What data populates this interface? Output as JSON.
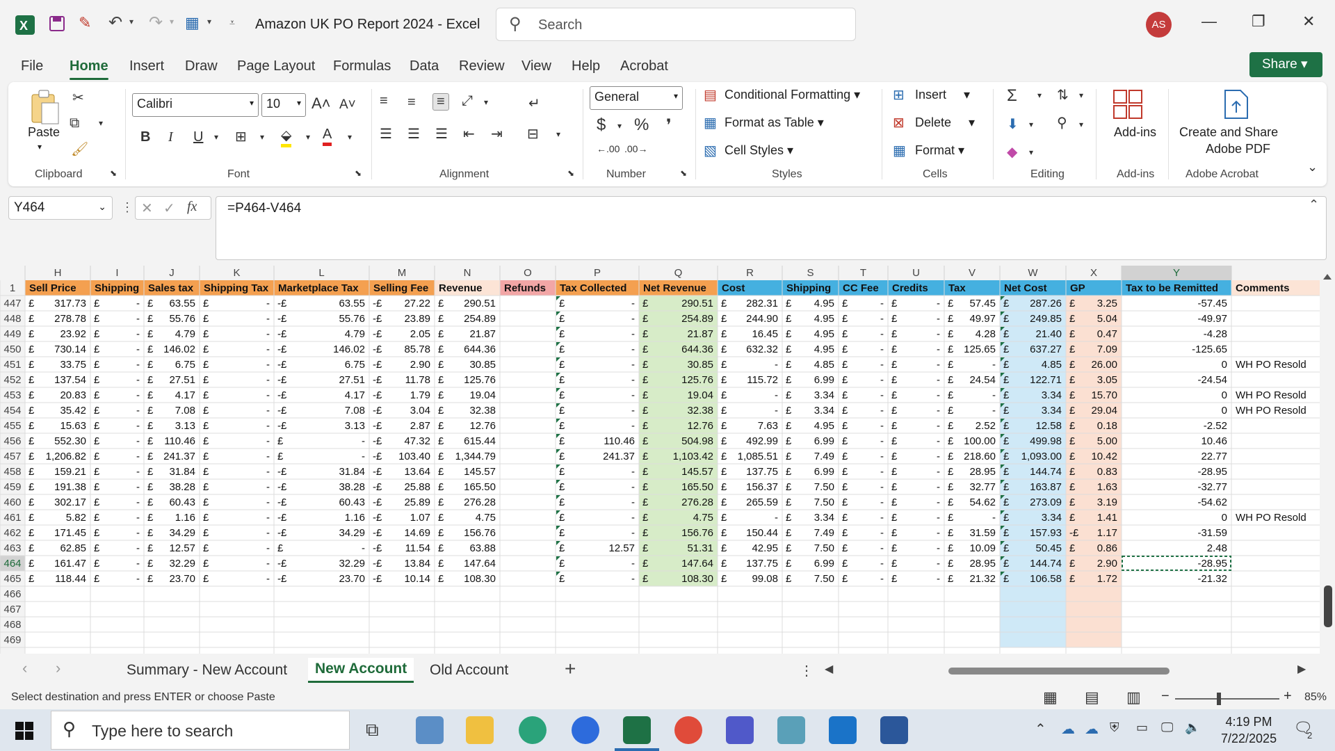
{
  "window": {
    "doc_title": "Amazon UK PO Report 2024  -  Excel",
    "search_placeholder": "Search",
    "avatar_initials": "AS"
  },
  "menu_tabs": [
    "File",
    "Home",
    "Insert",
    "Draw",
    "Page Layout",
    "Formulas",
    "Data",
    "Review",
    "View",
    "Help",
    "Acrobat"
  ],
  "active_menu_tab": "Home",
  "share_label": "Share",
  "ribbon": {
    "clipboard": {
      "paste": "Paste",
      "group": "Clipboard"
    },
    "font": {
      "name": "Calibri",
      "size": "10",
      "group": "Font"
    },
    "alignment": {
      "group": "Alignment"
    },
    "number": {
      "format": "General",
      "group": "Number"
    },
    "styles": {
      "conditional": "Conditional Formatting",
      "table": "Format as Table",
      "cell": "Cell Styles",
      "group": "Styles"
    },
    "cells": {
      "insert": "Insert",
      "delete": "Delete",
      "format": "Format",
      "group": "Cells"
    },
    "editing": {
      "group": "Editing"
    },
    "addins": {
      "label": "Add-ins",
      "group": "Add-ins"
    },
    "acrobat": {
      "label1": "Create and Share",
      "label2": "Adobe PDF",
      "group": "Adobe Acrobat"
    }
  },
  "formula_bar": {
    "cell_ref": "Y464",
    "fx": "fx",
    "formula": "=P464-V464"
  },
  "sheet": {
    "columns": [
      "H",
      "I",
      "J",
      "K",
      "L",
      "M",
      "N",
      "O",
      "P",
      "Q",
      "R",
      "S",
      "T",
      "U",
      "V",
      "W",
      "X",
      "Y",
      ""
    ],
    "headers": [
      "Sell Price",
      "Shipping",
      "Sales tax",
      "Shipping Tax",
      "Marketplace Tax",
      "Selling Fee",
      "Revenue",
      "Refunds",
      "Tax Collected",
      "Net Revenue",
      "Cost",
      "Shipping",
      "CC Fee",
      "Credits",
      "Tax",
      "Net Cost",
      "GP",
      "Tax to be Remitted",
      "Comments"
    ],
    "header_colors": [
      "#f4a050",
      "#f4a050",
      "#f4a050",
      "#f4a050",
      "#f4a050",
      "#f4a050",
      "#fce4d6",
      "#f2a6a6",
      "#f4a050",
      "#f4a050",
      "#45b0e0",
      "#45b0e0",
      "#45b0e0",
      "#45b0e0",
      "#45b0e0",
      "#45b0e0",
      "#45b0e0",
      "#45b0e0",
      "#fce4d6"
    ],
    "rows": [
      {
        "n": "447",
        "c": [
          "£ 317.73",
          "£ -",
          "£ 63.55",
          "£ -",
          "-£ 63.55",
          "-£ 27.22",
          "£ 290.51",
          "",
          "£ -",
          "£ 290.51",
          "£ 282.31",
          "£ 4.95",
          "£ -",
          "£ -",
          "£ 57.45",
          "£ 287.26",
          "£ 3.25",
          "-57.45",
          ""
        ]
      },
      {
        "n": "448",
        "c": [
          "£ 278.78",
          "£ -",
          "£ 55.76",
          "£ -",
          "-£ 55.76",
          "-£ 23.89",
          "£ 254.89",
          "",
          "£ -",
          "£ 254.89",
          "£ 244.90",
          "£ 4.95",
          "£ -",
          "£ -",
          "£ 49.97",
          "£ 249.85",
          "£ 5.04",
          "-49.97",
          ""
        ]
      },
      {
        "n": "449",
        "c": [
          "£ 23.92",
          "£ -",
          "£ 4.79",
          "£ -",
          "-£ 4.79",
          "-£ 2.05",
          "£ 21.87",
          "",
          "£ -",
          "£ 21.87",
          "£ 16.45",
          "£ 4.95",
          "£ -",
          "£ -",
          "£ 4.28",
          "£ 21.40",
          "£ 0.47",
          "-4.28",
          ""
        ]
      },
      {
        "n": "450",
        "c": [
          "£ 730.14",
          "£ -",
          "£ 146.02",
          "£ -",
          "-£ 146.02",
          "-£ 85.78",
          "£ 644.36",
          "",
          "£ -",
          "£ 644.36",
          "£ 632.32",
          "£ 4.95",
          "£ -",
          "£ -",
          "£ 125.65",
          "£ 637.27",
          "£ 7.09",
          "-125.65",
          ""
        ]
      },
      {
        "n": "451",
        "c": [
          "£ 33.75",
          "£ -",
          "£ 6.75",
          "£ -",
          "-£ 6.75",
          "-£ 2.90",
          "£ 30.85",
          "",
          "£ -",
          "£ 30.85",
          "£ -",
          "£ 4.85",
          "£ -",
          "£ -",
          "£ -",
          "£ 4.85",
          "£ 26.00",
          "0",
          "WH PO Resold"
        ]
      },
      {
        "n": "452",
        "c": [
          "£ 137.54",
          "£ -",
          "£ 27.51",
          "£ -",
          "-£ 27.51",
          "-£ 11.78",
          "£ 125.76",
          "",
          "£ -",
          "£ 125.76",
          "£ 115.72",
          "£ 6.99",
          "£ -",
          "£ -",
          "£ 24.54",
          "£ 122.71",
          "£ 3.05",
          "-24.54",
          ""
        ]
      },
      {
        "n": "453",
        "c": [
          "£ 20.83",
          "£ -",
          "£ 4.17",
          "£ -",
          "-£ 4.17",
          "-£ 1.79",
          "£ 19.04",
          "",
          "£ -",
          "£ 19.04",
          "£ -",
          "£ 3.34",
          "£ -",
          "£ -",
          "£ -",
          "£ 3.34",
          "£ 15.70",
          "0",
          "WH PO Resold"
        ]
      },
      {
        "n": "454",
        "c": [
          "£ 35.42",
          "£ -",
          "£ 7.08",
          "£ -",
          "-£ 7.08",
          "-£ 3.04",
          "£ 32.38",
          "",
          "£ -",
          "£ 32.38",
          "£ -",
          "£ 3.34",
          "£ -",
          "£ -",
          "£ -",
          "£ 3.34",
          "£ 29.04",
          "0",
          "WH PO Resold"
        ]
      },
      {
        "n": "455",
        "c": [
          "£ 15.63",
          "£ -",
          "£ 3.13",
          "£ -",
          "-£ 3.13",
          "-£ 2.87",
          "£ 12.76",
          "",
          "£ -",
          "£ 12.76",
          "£ 7.63",
          "£ 4.95",
          "£ -",
          "£ -",
          "£ 2.52",
          "£ 12.58",
          "£ 0.18",
          "-2.52",
          ""
        ]
      },
      {
        "n": "456",
        "c": [
          "£ 552.30",
          "£ -",
          "£ 110.46",
          "£ -",
          "£ -",
          "-£ 47.32",
          "£ 615.44",
          "",
          "£ 110.46",
          "£ 504.98",
          "£ 492.99",
          "£ 6.99",
          "£ -",
          "£ -",
          "£ 100.00",
          "£ 499.98",
          "£ 5.00",
          "10.46",
          ""
        ]
      },
      {
        "n": "457",
        "c": [
          "£ 1,206.82",
          "£ -",
          "£ 241.37",
          "£ -",
          "£ -",
          "-£ 103.40",
          "£ 1,344.79",
          "",
          "£ 241.37",
          "£ 1,103.42",
          "£ 1,085.51",
          "£ 7.49",
          "£ -",
          "£ -",
          "£ 218.60",
          "£ 1,093.00",
          "£ 10.42",
          "22.77",
          ""
        ]
      },
      {
        "n": "458",
        "c": [
          "£ 159.21",
          "£ -",
          "£ 31.84",
          "£ -",
          "-£ 31.84",
          "-£ 13.64",
          "£ 145.57",
          "",
          "£ -",
          "£ 145.57",
          "£ 137.75",
          "£ 6.99",
          "£ -",
          "£ -",
          "£ 28.95",
          "£ 144.74",
          "£ 0.83",
          "-28.95",
          ""
        ]
      },
      {
        "n": "459",
        "c": [
          "£ 191.38",
          "£ -",
          "£ 38.28",
          "£ -",
          "-£ 38.28",
          "-£ 25.88",
          "£ 165.50",
          "",
          "£ -",
          "£ 165.50",
          "£ 156.37",
          "£ 7.50",
          "£ -",
          "£ -",
          "£ 32.77",
          "£ 163.87",
          "£ 1.63",
          "-32.77",
          ""
        ]
      },
      {
        "n": "460",
        "c": [
          "£ 302.17",
          "£ -",
          "£ 60.43",
          "£ -",
          "-£ 60.43",
          "-£ 25.89",
          "£ 276.28",
          "",
          "£ -",
          "£ 276.28",
          "£ 265.59",
          "£ 7.50",
          "£ -",
          "£ -",
          "£ 54.62",
          "£ 273.09",
          "£ 3.19",
          "-54.62",
          ""
        ]
      },
      {
        "n": "461",
        "c": [
          "£ 5.82",
          "£ -",
          "£ 1.16",
          "£ -",
          "-£ 1.16",
          "-£ 1.07",
          "£ 4.75",
          "",
          "£ -",
          "£ 4.75",
          "£ -",
          "£ 3.34",
          "£ -",
          "£ -",
          "£ -",
          "£ 3.34",
          "£ 1.41",
          "0",
          "WH PO Resold"
        ]
      },
      {
        "n": "462",
        "c": [
          "£ 171.45",
          "£ -",
          "£ 34.29",
          "£ -",
          "-£ 34.29",
          "-£ 14.69",
          "£ 156.76",
          "",
          "£ -",
          "£ 156.76",
          "£ 150.44",
          "£ 7.49",
          "£ -",
          "£ -",
          "£ 31.59",
          "£ 157.93",
          "-£ 1.17",
          "-31.59",
          ""
        ]
      },
      {
        "n": "463",
        "c": [
          "£ 62.85",
          "£ -",
          "£ 12.57",
          "£ -",
          "£ -",
          "-£ 11.54",
          "£ 63.88",
          "",
          "£ 12.57",
          "£ 51.31",
          "£ 42.95",
          "£ 7.50",
          "£ -",
          "£ -",
          "£ 10.09",
          "£ 50.45",
          "£ 0.86",
          "2.48",
          ""
        ]
      },
      {
        "n": "464",
        "c": [
          "£ 161.47",
          "£ -",
          "£ 32.29",
          "£ -",
          "-£ 32.29",
          "-£ 13.84",
          "£ 147.64",
          "",
          "£ -",
          "£ 147.64",
          "£ 137.75",
          "£ 6.99",
          "£ -",
          "£ -",
          "£ 28.95",
          "£ 144.74",
          "£ 2.90",
          "-28.95",
          ""
        ]
      },
      {
        "n": "465",
        "c": [
          "£ 118.44",
          "£ -",
          "£ 23.70",
          "£ -",
          "-£ 23.70",
          "-£ 10.14",
          "£ 108.30",
          "",
          "£ -",
          "£ 108.30",
          "£ 99.08",
          "£ 7.50",
          "£ -",
          "£ -",
          "£ 21.32",
          "£ 106.58",
          "£ 1.72",
          "-21.32",
          ""
        ]
      },
      {
        "n": "466",
        "c": []
      },
      {
        "n": "467",
        "c": []
      },
      {
        "n": "468",
        "c": []
      },
      {
        "n": "469",
        "c": []
      }
    ],
    "header_row_number": "1",
    "selected_row": "464",
    "selected_col": "Y"
  },
  "sheet_tabs": [
    "Summary - New Account",
    "New Account",
    "Old Account"
  ],
  "active_sheet": "New Account",
  "status": {
    "message": "Select destination and press ENTER or choose Paste",
    "zoom": "85%"
  },
  "taskbar": {
    "search": "Type here to search",
    "time": "4:19 PM",
    "date": "7/22/2025",
    "notif": "2"
  }
}
